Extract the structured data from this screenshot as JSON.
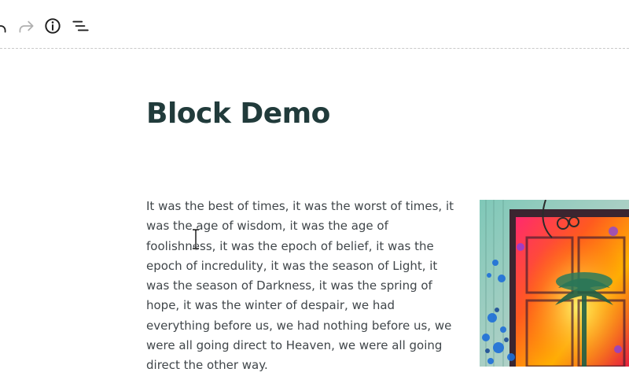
{
  "toolbar": {
    "icons": {
      "undo": "undo-icon",
      "redo": "redo-icon",
      "info": "info-icon",
      "outline": "list-view-icon"
    }
  },
  "document": {
    "title": "Block Demo",
    "paragraph": "It was the best of times, it was the worst of times, it was the age of wisdom, it was the age of foolishness, it was the epoch of belief, it was the epoch of incredulity, it was the season of Light, it was the season of Darkness, it was the spring of hope, it was the winter of despair, we had everything before us, we had nothing before us, we were all going direct to Heaven, we were all going direct the other way.",
    "image": {
      "subject": "colorful painted door"
    }
  },
  "colors": {
    "title": "#213b3b",
    "body_text": "#40464a",
    "icon_active": "#1e1e1e",
    "icon_disabled": "#b0b0b0",
    "divider": "#c9c9c9"
  }
}
